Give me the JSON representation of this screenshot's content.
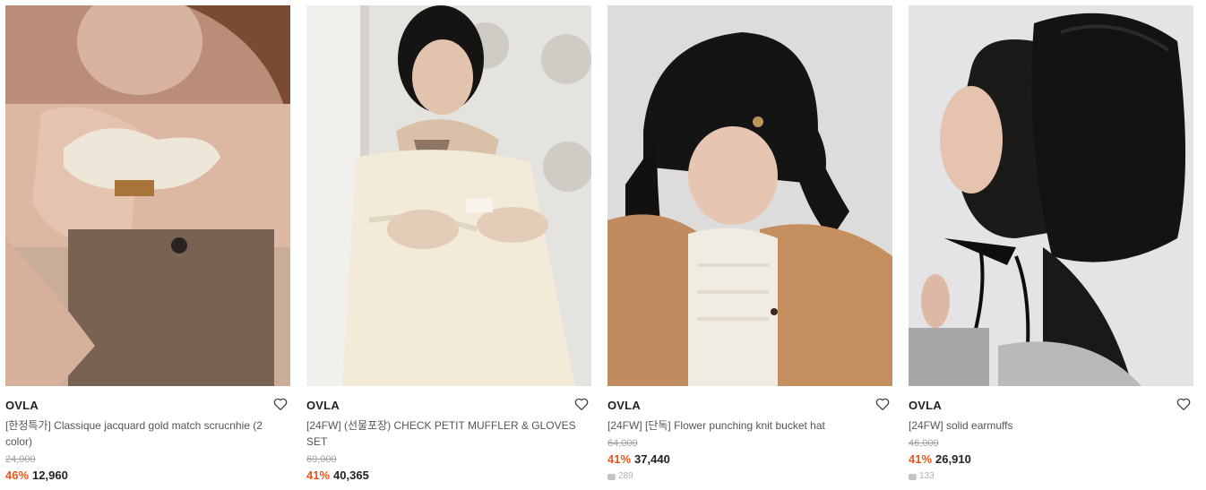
{
  "products": [
    {
      "brand": "OVLA",
      "title": "[한정특가] Classique jacquard gold match scrucnhie (2 color)",
      "original_price": "24,000",
      "discount": "46%",
      "price": "12,960",
      "reviews": ""
    },
    {
      "brand": "OVLA",
      "title": "[24FW] (선물포장) CHECK PETIT MUFFLER & GLOVES SET",
      "original_price": "69,000",
      "discount": "41%",
      "price": "40,365",
      "reviews": ""
    },
    {
      "brand": "OVLA",
      "title": "[24FW] [단독] Flower punching knit bucket hat",
      "original_price": "64,000",
      "discount": "41%",
      "price": "37,440",
      "reviews": "289"
    },
    {
      "brand": "OVLA",
      "title": "[24FW] solid earmuffs",
      "original_price": "46,000",
      "discount": "41%",
      "price": "26,910",
      "reviews": "133"
    }
  ],
  "icons": {
    "wishlist": "heart-outline-icon",
    "reviews": "review-bubble-icon"
  },
  "colors": {
    "discount": "#e8561e",
    "price": "#222222",
    "original_price": "#a0a0a0"
  }
}
